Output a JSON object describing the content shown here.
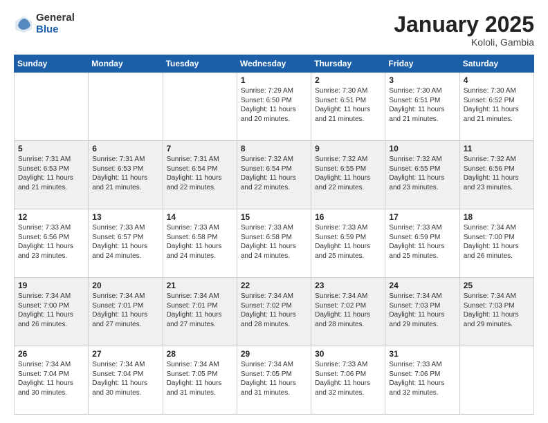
{
  "header": {
    "logo_general": "General",
    "logo_blue": "Blue",
    "month_title": "January 2025",
    "location": "Kololi, Gambia"
  },
  "weekdays": [
    "Sunday",
    "Monday",
    "Tuesday",
    "Wednesday",
    "Thursday",
    "Friday",
    "Saturday"
  ],
  "weeks": [
    [
      {
        "day": "",
        "info": ""
      },
      {
        "day": "",
        "info": ""
      },
      {
        "day": "",
        "info": ""
      },
      {
        "day": "1",
        "info": "Sunrise: 7:29 AM\nSunset: 6:50 PM\nDaylight: 11 hours\nand 20 minutes."
      },
      {
        "day": "2",
        "info": "Sunrise: 7:30 AM\nSunset: 6:51 PM\nDaylight: 11 hours\nand 21 minutes."
      },
      {
        "day": "3",
        "info": "Sunrise: 7:30 AM\nSunset: 6:51 PM\nDaylight: 11 hours\nand 21 minutes."
      },
      {
        "day": "4",
        "info": "Sunrise: 7:30 AM\nSunset: 6:52 PM\nDaylight: 11 hours\nand 21 minutes."
      }
    ],
    [
      {
        "day": "5",
        "info": "Sunrise: 7:31 AM\nSunset: 6:53 PM\nDaylight: 11 hours\nand 21 minutes."
      },
      {
        "day": "6",
        "info": "Sunrise: 7:31 AM\nSunset: 6:53 PM\nDaylight: 11 hours\nand 21 minutes."
      },
      {
        "day": "7",
        "info": "Sunrise: 7:31 AM\nSunset: 6:54 PM\nDaylight: 11 hours\nand 22 minutes."
      },
      {
        "day": "8",
        "info": "Sunrise: 7:32 AM\nSunset: 6:54 PM\nDaylight: 11 hours\nand 22 minutes."
      },
      {
        "day": "9",
        "info": "Sunrise: 7:32 AM\nSunset: 6:55 PM\nDaylight: 11 hours\nand 22 minutes."
      },
      {
        "day": "10",
        "info": "Sunrise: 7:32 AM\nSunset: 6:55 PM\nDaylight: 11 hours\nand 23 minutes."
      },
      {
        "day": "11",
        "info": "Sunrise: 7:32 AM\nSunset: 6:56 PM\nDaylight: 11 hours\nand 23 minutes."
      }
    ],
    [
      {
        "day": "12",
        "info": "Sunrise: 7:33 AM\nSunset: 6:56 PM\nDaylight: 11 hours\nand 23 minutes."
      },
      {
        "day": "13",
        "info": "Sunrise: 7:33 AM\nSunset: 6:57 PM\nDaylight: 11 hours\nand 24 minutes."
      },
      {
        "day": "14",
        "info": "Sunrise: 7:33 AM\nSunset: 6:58 PM\nDaylight: 11 hours\nand 24 minutes."
      },
      {
        "day": "15",
        "info": "Sunrise: 7:33 AM\nSunset: 6:58 PM\nDaylight: 11 hours\nand 24 minutes."
      },
      {
        "day": "16",
        "info": "Sunrise: 7:33 AM\nSunset: 6:59 PM\nDaylight: 11 hours\nand 25 minutes."
      },
      {
        "day": "17",
        "info": "Sunrise: 7:33 AM\nSunset: 6:59 PM\nDaylight: 11 hours\nand 25 minutes."
      },
      {
        "day": "18",
        "info": "Sunrise: 7:34 AM\nSunset: 7:00 PM\nDaylight: 11 hours\nand 26 minutes."
      }
    ],
    [
      {
        "day": "19",
        "info": "Sunrise: 7:34 AM\nSunset: 7:00 PM\nDaylight: 11 hours\nand 26 minutes."
      },
      {
        "day": "20",
        "info": "Sunrise: 7:34 AM\nSunset: 7:01 PM\nDaylight: 11 hours\nand 27 minutes."
      },
      {
        "day": "21",
        "info": "Sunrise: 7:34 AM\nSunset: 7:01 PM\nDaylight: 11 hours\nand 27 minutes."
      },
      {
        "day": "22",
        "info": "Sunrise: 7:34 AM\nSunset: 7:02 PM\nDaylight: 11 hours\nand 28 minutes."
      },
      {
        "day": "23",
        "info": "Sunrise: 7:34 AM\nSunset: 7:02 PM\nDaylight: 11 hours\nand 28 minutes."
      },
      {
        "day": "24",
        "info": "Sunrise: 7:34 AM\nSunset: 7:03 PM\nDaylight: 11 hours\nand 29 minutes."
      },
      {
        "day": "25",
        "info": "Sunrise: 7:34 AM\nSunset: 7:03 PM\nDaylight: 11 hours\nand 29 minutes."
      }
    ],
    [
      {
        "day": "26",
        "info": "Sunrise: 7:34 AM\nSunset: 7:04 PM\nDaylight: 11 hours\nand 30 minutes."
      },
      {
        "day": "27",
        "info": "Sunrise: 7:34 AM\nSunset: 7:04 PM\nDaylight: 11 hours\nand 30 minutes."
      },
      {
        "day": "28",
        "info": "Sunrise: 7:34 AM\nSunset: 7:05 PM\nDaylight: 11 hours\nand 31 minutes."
      },
      {
        "day": "29",
        "info": "Sunrise: 7:34 AM\nSunset: 7:05 PM\nDaylight: 11 hours\nand 31 minutes."
      },
      {
        "day": "30",
        "info": "Sunrise: 7:33 AM\nSunset: 7:06 PM\nDaylight: 11 hours\nand 32 minutes."
      },
      {
        "day": "31",
        "info": "Sunrise: 7:33 AM\nSunset: 7:06 PM\nDaylight: 11 hours\nand 32 minutes."
      },
      {
        "day": "",
        "info": ""
      }
    ]
  ]
}
